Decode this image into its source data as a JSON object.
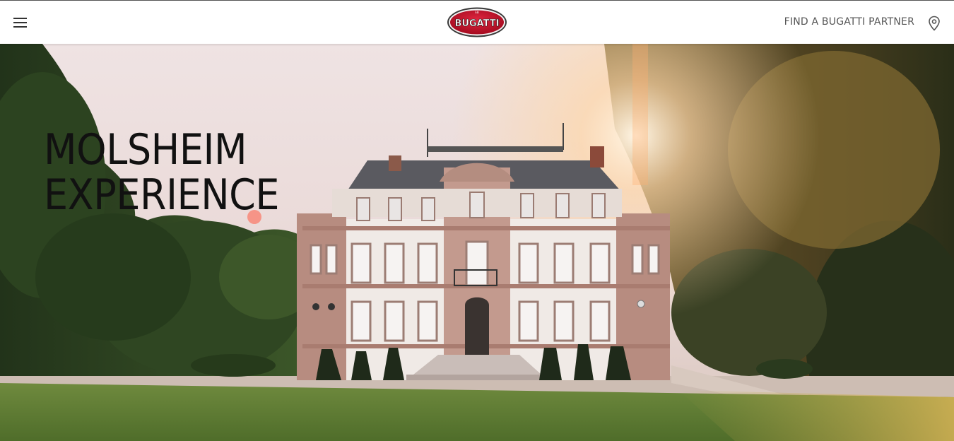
{
  "header": {
    "menu_label": "Menu",
    "logo_text": "BUGATTI",
    "partner_link": "FIND A BUGATTI PARTNER",
    "menu_icon": "hamburger-icon",
    "pin_icon": "location-pin-icon"
  },
  "hero": {
    "title_line1": "MOLSHEIM",
    "title_line2": "EXPERIENCE"
  },
  "colors": {
    "brand_red": "#c8102e",
    "text_dark": "#111111",
    "nav_text": "#555555"
  }
}
